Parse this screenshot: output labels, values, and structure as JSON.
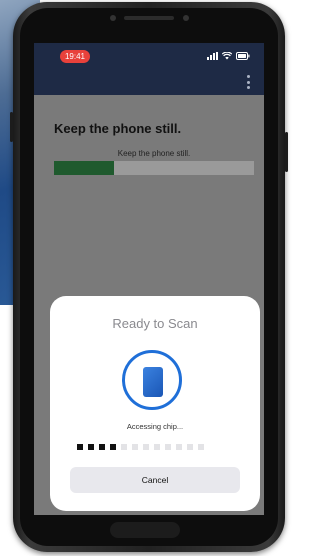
{
  "status_bar": {
    "time": "19:41",
    "time_pill_color": "#e8413b",
    "icons": [
      "signal-icon",
      "wifi-icon",
      "battery-icon"
    ]
  },
  "app_bar": {
    "menu_icon": "kebab-icon",
    "background_color": "#1e2a45"
  },
  "main": {
    "heading": "Keep the phone still.",
    "subtext": "Keep the phone still.",
    "progress": 0.3,
    "progress_color": "#1f5a2e"
  },
  "scan_sheet": {
    "title": "Ready to Scan",
    "icon": "phone-icon",
    "accent_color": "#1f6fd8",
    "status_text": "Accessing chip...",
    "progress_dots_total": 12,
    "progress_dots_filled": 4,
    "cancel_label": "Cancel"
  }
}
